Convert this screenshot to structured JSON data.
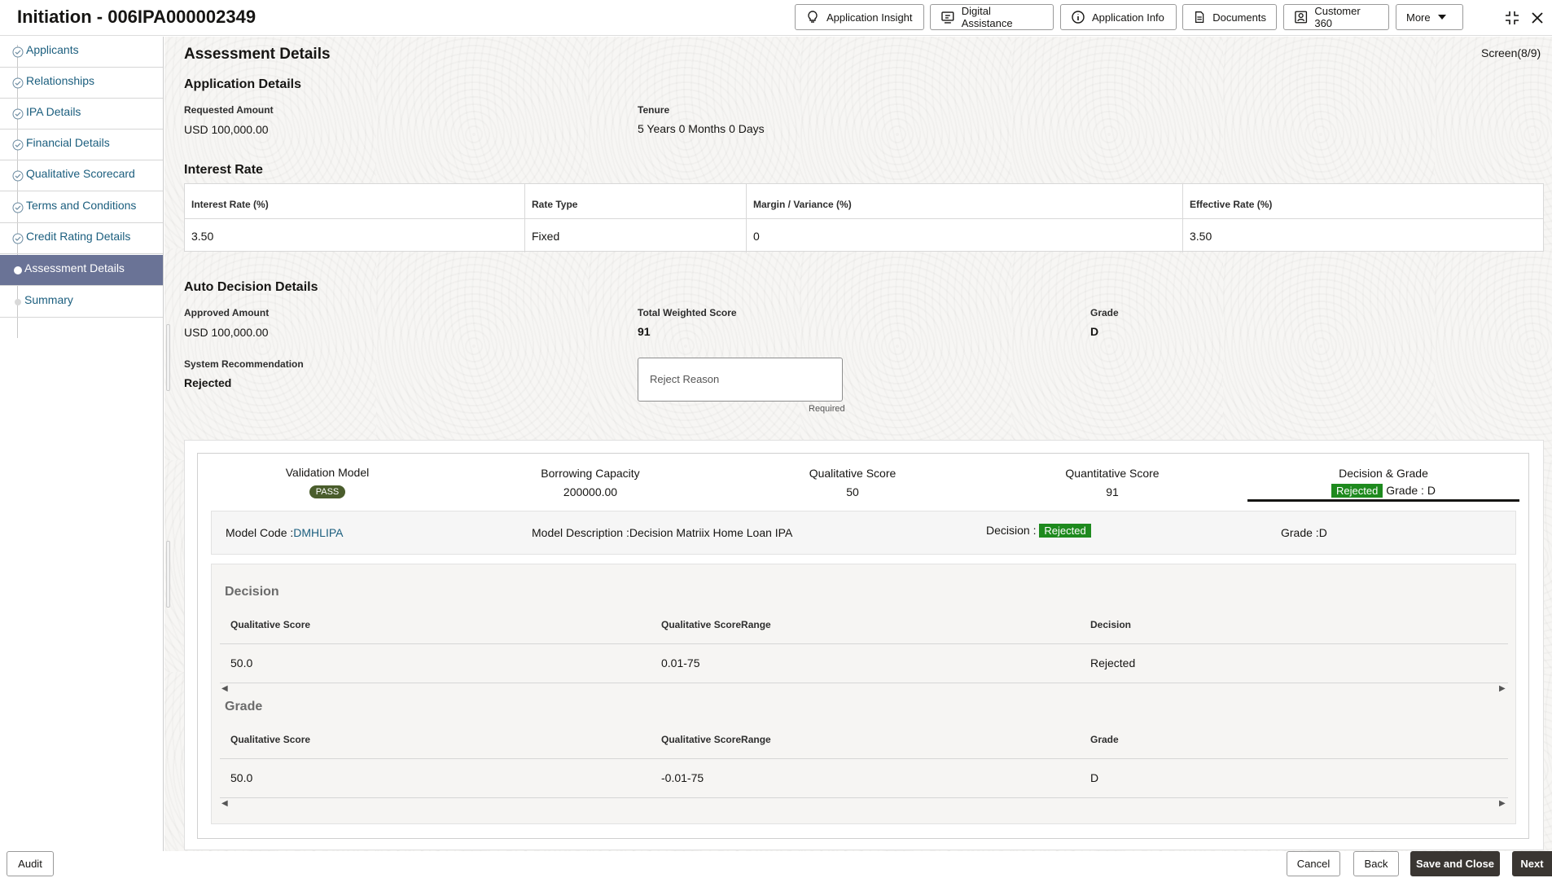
{
  "header": {
    "title": "Initiation - 006IPA000002349",
    "buttons": {
      "insight": "Application Insight",
      "digital": "Digital Assistance",
      "info": "Application Info",
      "documents": "Documents",
      "customer360": "Customer 360",
      "more": "More"
    }
  },
  "sidebar": {
    "steps": [
      {
        "label": "Applicants"
      },
      {
        "label": "Relationships"
      },
      {
        "label": "IPA Details"
      },
      {
        "label": "Financial Details"
      },
      {
        "label": "Qualitative Scorecard"
      },
      {
        "label": "Terms and Conditions"
      },
      {
        "label": "Credit Rating Details"
      },
      {
        "label": "Assessment Details"
      },
      {
        "label": "Summary"
      }
    ]
  },
  "page": {
    "title": "Assessment Details",
    "screen": "Screen(8/9)"
  },
  "application": {
    "title": "Application Details",
    "requested_label": "Requested Amount",
    "requested_value": "USD 100,000.00",
    "tenure_label": "Tenure",
    "tenure_value": "5 Years 0 Months 0 Days"
  },
  "interest": {
    "title": "Interest Rate",
    "headers": [
      "Interest Rate (%)",
      "Rate Type",
      "Margin / Variance (%)",
      "Effective Rate (%)"
    ],
    "values": [
      "3.50",
      "Fixed",
      "0",
      "3.50"
    ]
  },
  "auto": {
    "title": "Auto Decision Details",
    "approved_label": "Approved Amount",
    "approved_value": "USD 100,000.00",
    "weighted_label": "Total Weighted Score",
    "weighted_value": "91",
    "grade_label": "Grade",
    "grade_value": "D",
    "recommendation_label": "System Recommendation",
    "recommendation_value": "Rejected",
    "reject_placeholder": "Reject Reason",
    "required": "Required"
  },
  "scores": {
    "validation_label": "Validation Model",
    "validation_value": "PASS",
    "borrowing_label": "Borrowing Capacity",
    "borrowing_value": "200000.00",
    "qualitative_label": "Qualitative Score",
    "qualitative_value": "50",
    "quantitative_label": "Quantitative Score",
    "quantitative_value": "91",
    "decision_label": "Decision & Grade",
    "decision_value": "Rejected",
    "grade_text": "Grade : D"
  },
  "model": {
    "code_label": "Model Code :",
    "code_value": "DMHLIPA",
    "desc": "Model Description :Decision Matriix Home Loan IPA",
    "decision_label": "Decision :",
    "decision_value": "Rejected",
    "grade": "Grade :D"
  },
  "decision_table": {
    "title": "Decision",
    "headers": [
      "Qualitative Score",
      "Qualitative ScoreRange",
      "Decision"
    ],
    "row": [
      "50.0",
      "0.01-75",
      "Rejected"
    ]
  },
  "grade_table": {
    "title": "Grade",
    "headers": [
      "Qualitative Score",
      "Qualitative ScoreRange",
      "Grade"
    ],
    "row": [
      "50.0",
      "-0.01-75",
      "D"
    ]
  },
  "footer": {
    "audit": "Audit",
    "cancel": "Cancel",
    "back": "Back",
    "save_close": "Save and Close",
    "next": "Next"
  }
}
